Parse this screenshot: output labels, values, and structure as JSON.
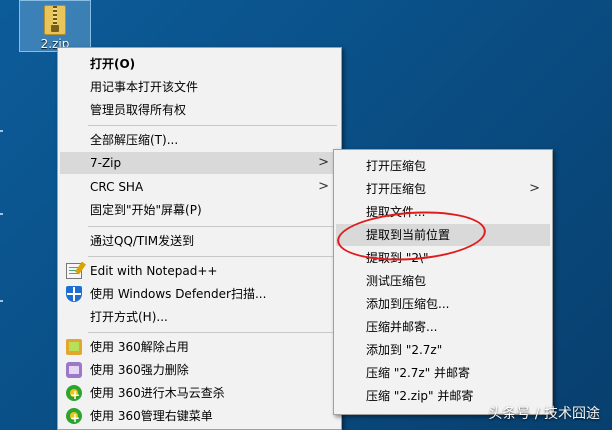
{
  "desktop": {
    "file_icon": "zip-file-icon",
    "file_label": "2.zip"
  },
  "context_menu": {
    "items": [
      "打开(O)",
      "用记事本打开该文件",
      "管理员取得所有权",
      "全部解压缩(T)...",
      "7-Zip",
      "CRC SHA",
      "固定到\"开始\"屏幕(P)",
      "通过QQ/TIM发送到",
      "Edit with Notepad++",
      "使用 Windows Defender扫描...",
      "打开方式(H)...",
      "使用 360解除占用",
      "使用 360强力删除",
      "使用 360进行木马云查杀",
      "使用 360管理右键菜单"
    ],
    "highlighted": "7-Zip"
  },
  "submenu_7zip": {
    "items": [
      "打开压缩包",
      "打开压缩包",
      "提取文件...",
      "提取到当前位置",
      "提取到 \"2\\\"",
      "测试压缩包",
      "添加到压缩包...",
      "压缩并邮寄...",
      "添加到 \"2.7z\"",
      "压缩 \"2.7z\" 并邮寄",
      "压缩 \"2.zip\" 并邮寄"
    ],
    "highlighted": "提取到当前位置"
  },
  "icons": {
    "notepad": "notepad-icon",
    "defender": "shield-icon",
    "unlock": "unlock-icon",
    "erase": "erase-icon",
    "trojan": "trojan-scan-icon",
    "rmenu": "menu-manage-icon",
    "submenu_arrow": "chevron-right-icon"
  },
  "colors": {
    "highlight": "#d9d9d9",
    "annotation": "#e01b1b",
    "desktop": "#0a4f86"
  },
  "watermark": "头条号 / 技术囧途"
}
